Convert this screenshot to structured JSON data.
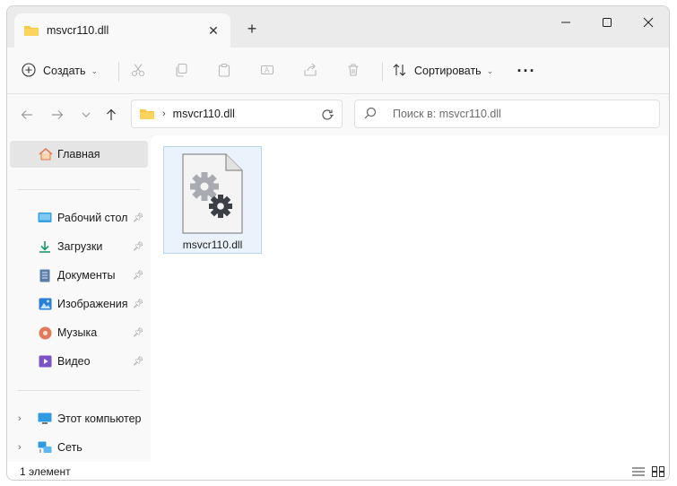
{
  "tab": {
    "title": "msvcr110.dll",
    "close_icon": "close-icon",
    "new_tab": "+"
  },
  "commands": {
    "new_label": "Создать",
    "sort_label": "Сортировать",
    "more": "···"
  },
  "address": {
    "path": "msvcr110.dll"
  },
  "search": {
    "placeholder": "Поиск в: msvcr110.dll"
  },
  "sidebar": {
    "home": "Главная",
    "quick": [
      {
        "label": "Рабочий стол",
        "icon": "desktop-icon"
      },
      {
        "label": "Загрузки",
        "icon": "download-icon"
      },
      {
        "label": "Документы",
        "icon": "documents-icon"
      },
      {
        "label": "Изображения",
        "icon": "pictures-icon"
      },
      {
        "label": "Музыка",
        "icon": "music-icon"
      },
      {
        "label": "Видео",
        "icon": "video-icon"
      }
    ],
    "tree": [
      {
        "label": "Этот компьютер",
        "icon": "computer-icon"
      },
      {
        "label": "Сеть",
        "icon": "network-icon"
      }
    ]
  },
  "files": [
    {
      "name": "msvcr110.dll",
      "icon": "dll-file-icon"
    }
  ],
  "status": {
    "count": "1 элемент"
  },
  "colors": {
    "accent": "#0067c0",
    "folder": "#f8c743",
    "selection": "#eaf3fb"
  }
}
